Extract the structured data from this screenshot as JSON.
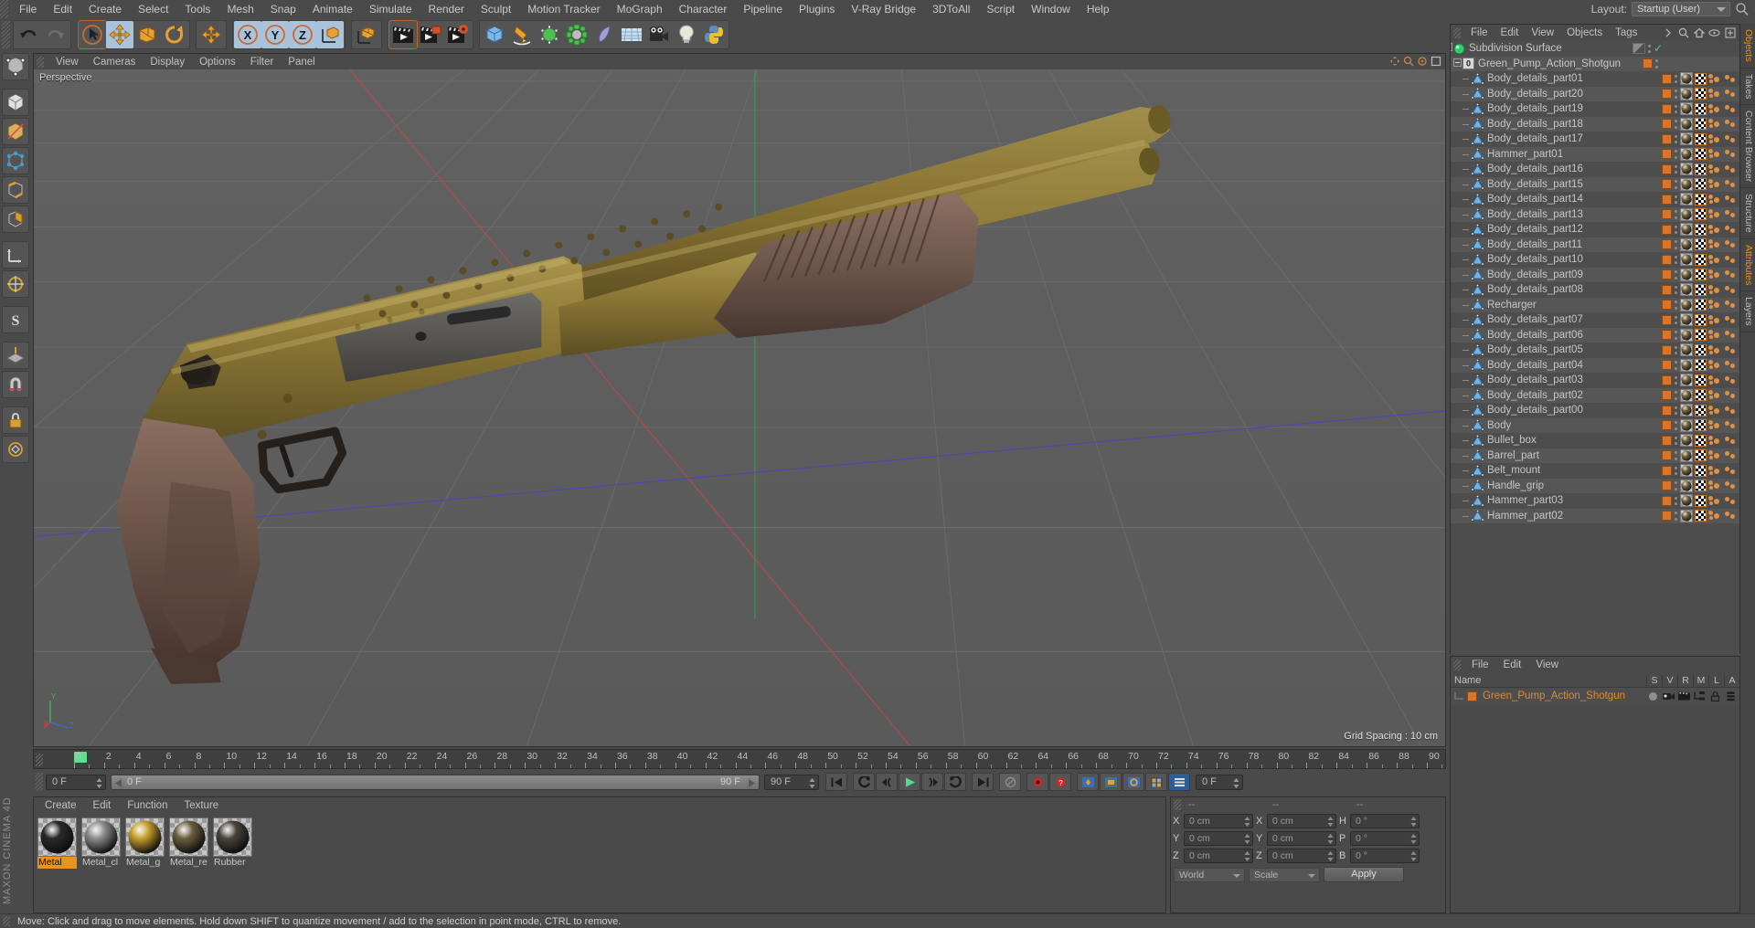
{
  "app": {
    "brand": "MAXON CINEMA 4D",
    "layout_label": "Layout:",
    "layout_value": "Startup (User)"
  },
  "menubar": {
    "items": [
      "File",
      "Edit",
      "Create",
      "Select",
      "Tools",
      "Mesh",
      "Snap",
      "Animate",
      "Simulate",
      "Render",
      "Sculpt",
      "Motion Tracker",
      "MoGraph",
      "Character",
      "Pipeline",
      "Plugins",
      "V-Ray Bridge",
      "3DToAll",
      "Script",
      "Window",
      "Help"
    ]
  },
  "toolbar": {
    "groups": [
      {
        "buttons": [
          {
            "name": "undo-button",
            "icon": "undo",
            "state": "normal"
          },
          {
            "name": "redo-button",
            "icon": "redo",
            "state": "disabled"
          }
        ]
      },
      {
        "buttons": [
          {
            "name": "live-selection-tool",
            "icon": "cursor-circle",
            "state": "hot"
          },
          {
            "name": "move-tool",
            "icon": "move-arrows",
            "state": "selected"
          },
          {
            "name": "scale-tool",
            "icon": "scale-box",
            "state": "normal"
          },
          {
            "name": "rotate-tool",
            "icon": "rotate-circle",
            "state": "normal"
          }
        ]
      },
      {
        "buttons": [
          {
            "name": "move-axis-tool",
            "icon": "move-arrows-2",
            "state": "normal"
          }
        ]
      },
      {
        "buttons": [
          {
            "name": "lock-x-axis",
            "icon": "axis-x",
            "state": "selected"
          },
          {
            "name": "lock-y-axis",
            "icon": "axis-y",
            "state": "selected"
          },
          {
            "name": "lock-z-axis",
            "icon": "axis-z",
            "state": "selected"
          },
          {
            "name": "world-object-coordinate",
            "icon": "world-cube",
            "state": "selected"
          }
        ]
      },
      {
        "buttons": [
          {
            "name": "coordinate-system-button",
            "icon": "cube-axis",
            "state": "normal"
          }
        ]
      },
      {
        "buttons": [
          {
            "name": "render-view-button",
            "icon": "clapper",
            "state": "hot"
          },
          {
            "name": "render-region-button",
            "icon": "clapper-region",
            "state": "normal"
          },
          {
            "name": "render-settings-button",
            "icon": "clapper-gear",
            "state": "normal"
          }
        ]
      },
      {
        "buttons": [
          {
            "name": "add-cube-button",
            "icon": "cube-blue",
            "state": "normal"
          },
          {
            "name": "spline-pen-button",
            "icon": "pen",
            "state": "normal"
          },
          {
            "name": "generator-button",
            "icon": "cube-green",
            "state": "normal"
          },
          {
            "name": "mograph-button",
            "icon": "cluster-green",
            "state": "normal"
          },
          {
            "name": "deformer-button",
            "icon": "bend-purple",
            "state": "normal"
          },
          {
            "name": "scene-object-button",
            "icon": "floor-grid",
            "state": "normal"
          },
          {
            "name": "camera-button",
            "icon": "camera",
            "state": "normal"
          },
          {
            "name": "light-button",
            "icon": "light-bulb",
            "state": "normal"
          },
          {
            "name": "python-button",
            "icon": "python",
            "state": "normal"
          }
        ]
      }
    ]
  },
  "left_toolbar": {
    "buttons": [
      {
        "name": "make-editable-button",
        "icon": "make-editable"
      },
      {
        "name": "model-mode-button",
        "icon": "model-cube"
      },
      {
        "name": "texture-mode-button",
        "icon": "texture-axis"
      },
      {
        "name": "points-mode-button",
        "icon": "points"
      },
      {
        "name": "edges-mode-button",
        "icon": "edges"
      },
      {
        "name": "polygons-mode-button",
        "icon": "polygons"
      },
      {
        "name": "object-axis-button",
        "icon": "object-axis"
      },
      {
        "name": "enable-axis-button",
        "icon": "enable-axis"
      },
      {
        "name": "viewport-solo-button",
        "icon": "viewport-solo"
      },
      {
        "name": "workplane-button",
        "icon": "workplane"
      },
      {
        "name": "snap-button",
        "icon": "magnet"
      },
      {
        "name": "lock-workplane-button",
        "icon": "lock-plane"
      },
      {
        "name": "quantize-button",
        "icon": "quantize"
      }
    ]
  },
  "viewport": {
    "menu": [
      "View",
      "Cameras",
      "Display",
      "Options",
      "Filter",
      "Panel"
    ],
    "camera_name": "Perspective",
    "grid_spacing": "Grid Spacing : 10 cm",
    "axis_labels": [
      "X",
      "Y",
      "Z"
    ]
  },
  "timeline": {
    "ticks": [
      "0",
      "2",
      "4",
      "6",
      "8",
      "10",
      "12",
      "14",
      "16",
      "18",
      "20",
      "22",
      "24",
      "26",
      "28",
      "30",
      "32",
      "34",
      "36",
      "38",
      "40",
      "42",
      "44",
      "46",
      "48",
      "50",
      "52",
      "54",
      "56",
      "58",
      "60",
      "62",
      "64",
      "66",
      "68",
      "70",
      "72",
      "74",
      "76",
      "78",
      "80",
      "82",
      "84",
      "86",
      "88",
      "90"
    ],
    "current_frame": "0 F",
    "start_field": "0 F",
    "preview_min": "0 F",
    "preview_max": "90 F",
    "end_field": "90 F",
    "fps_right": "0 F",
    "transport": [
      {
        "name": "go-to-start-button",
        "icon": "skip-start"
      },
      {
        "name": "previous-keyframe-button",
        "icon": "prev-key"
      },
      {
        "name": "step-back-button",
        "icon": "step-back"
      },
      {
        "name": "play-button",
        "icon": "play"
      },
      {
        "name": "step-forward-button",
        "icon": "step-forward"
      },
      {
        "name": "next-keyframe-button",
        "icon": "next-key"
      },
      {
        "name": "go-to-end-button",
        "icon": "skip-end"
      }
    ],
    "record_buttons": [
      {
        "name": "record-active-objects-button",
        "icon": "record"
      },
      {
        "name": "autokeying-button",
        "icon": "autokey"
      },
      {
        "name": "keyframe-position-button",
        "icon": "key-pos"
      },
      {
        "name": "keyframe-scale-button",
        "icon": "key-scale"
      },
      {
        "name": "keyframe-rotation-button",
        "icon": "key-rot"
      },
      {
        "name": "keyframe-param-button",
        "icon": "key-param"
      },
      {
        "name": "keyframe-pla-button",
        "icon": "key-pla"
      }
    ]
  },
  "materials": {
    "menu": [
      "Create",
      "Edit",
      "Function",
      "Texture"
    ],
    "items": [
      {
        "name": "Metal",
        "selected": true,
        "color": "#2a2a2a"
      },
      {
        "name": "Metal_cl",
        "selected": false,
        "color": "#8d8d8d"
      },
      {
        "name": "Metal_g",
        "selected": false,
        "color": "#c9a02a"
      },
      {
        "name": "Metal_re",
        "selected": false,
        "color": "#6d6040"
      },
      {
        "name": "Rubber",
        "selected": false,
        "color": "#4c443d"
      }
    ]
  },
  "coordinates": {
    "headers": [
      "--",
      "--",
      "--"
    ],
    "rows": [
      {
        "label1": "X",
        "value1": "0 cm",
        "label2": "X",
        "value2": "0 cm",
        "label3": "H",
        "value3": "0 °"
      },
      {
        "label1": "Y",
        "value1": "0 cm",
        "label2": "Y",
        "value2": "0 cm",
        "label3": "P",
        "value3": "0 °"
      },
      {
        "label1": "Z",
        "value1": "0 cm",
        "label2": "Z",
        "value2": "0 cm",
        "label3": "B",
        "value3": "0 °"
      }
    ],
    "system": "World",
    "mode": "Scale",
    "apply_label": "Apply"
  },
  "object_manager": {
    "menu": [
      "File",
      "Edit",
      "View",
      "Objects",
      "Tags"
    ],
    "icons": [
      "search-icon",
      "home-icon",
      "eye-icon",
      "expand-icon"
    ],
    "items": [
      {
        "label": "Subdivision Surface",
        "icon": "subdivision-surface-icon",
        "depth": 0,
        "has_tag": false,
        "checked": true
      },
      {
        "label": "Green_Pump_Action_Shotgun",
        "icon": "layer-null-icon",
        "depth": 1,
        "has_tag": true,
        "tags": 0
      },
      {
        "label": "Body_details_part01",
        "icon": "polygon-object-icon",
        "depth": 2,
        "has_tag": true,
        "tags": 3
      },
      {
        "label": "Body_details_part20",
        "icon": "polygon-object-icon",
        "depth": 2,
        "has_tag": true,
        "tags": 3
      },
      {
        "label": "Body_details_part19",
        "icon": "polygon-object-icon",
        "depth": 2,
        "has_tag": true,
        "tags": 3
      },
      {
        "label": "Body_details_part18",
        "icon": "polygon-object-icon",
        "depth": 2,
        "has_tag": true,
        "tags": 3
      },
      {
        "label": "Body_details_part17",
        "icon": "polygon-object-icon",
        "depth": 2,
        "has_tag": true,
        "tags": 3
      },
      {
        "label": "Hammer_part01",
        "icon": "polygon-object-icon",
        "depth": 2,
        "has_tag": true,
        "tags": 3
      },
      {
        "label": "Body_details_part16",
        "icon": "polygon-object-icon",
        "depth": 2,
        "has_tag": true,
        "tags": 3
      },
      {
        "label": "Body_details_part15",
        "icon": "polygon-object-icon",
        "depth": 2,
        "has_tag": true,
        "tags": 3
      },
      {
        "label": "Body_details_part14",
        "icon": "polygon-object-icon",
        "depth": 2,
        "has_tag": true,
        "tags": 3
      },
      {
        "label": "Body_details_part13",
        "icon": "polygon-object-icon",
        "depth": 2,
        "has_tag": true,
        "tags": 3
      },
      {
        "label": "Body_details_part12",
        "icon": "polygon-object-icon",
        "depth": 2,
        "has_tag": true,
        "tags": 3
      },
      {
        "label": "Body_details_part11",
        "icon": "polygon-object-icon",
        "depth": 2,
        "has_tag": true,
        "tags": 3
      },
      {
        "label": "Body_details_part10",
        "icon": "polygon-object-icon",
        "depth": 2,
        "has_tag": true,
        "tags": 3
      },
      {
        "label": "Body_details_part09",
        "icon": "polygon-object-icon",
        "depth": 2,
        "has_tag": true,
        "tags": 3
      },
      {
        "label": "Body_details_part08",
        "icon": "polygon-object-icon",
        "depth": 2,
        "has_tag": true,
        "tags": 3
      },
      {
        "label": "Recharger",
        "icon": "polygon-object-icon",
        "depth": 2,
        "has_tag": true,
        "tags": 3
      },
      {
        "label": "Body_details_part07",
        "icon": "polygon-object-icon",
        "depth": 2,
        "has_tag": true,
        "tags": 3
      },
      {
        "label": "Body_details_part06",
        "icon": "polygon-object-icon",
        "depth": 2,
        "has_tag": true,
        "tags": 3
      },
      {
        "label": "Body_details_part05",
        "icon": "polygon-object-icon",
        "depth": 2,
        "has_tag": true,
        "tags": 3
      },
      {
        "label": "Body_details_part04",
        "icon": "polygon-object-icon",
        "depth": 2,
        "has_tag": true,
        "tags": 3
      },
      {
        "label": "Body_details_part03",
        "icon": "polygon-object-icon",
        "depth": 2,
        "has_tag": true,
        "tags": 3
      },
      {
        "label": "Body_details_part02",
        "icon": "polygon-object-icon",
        "depth": 2,
        "has_tag": true,
        "tags": 3
      },
      {
        "label": "Body_details_part00",
        "icon": "polygon-object-icon",
        "depth": 2,
        "has_tag": true,
        "tags": 3
      },
      {
        "label": "Body",
        "icon": "polygon-object-icon",
        "depth": 2,
        "has_tag": true,
        "tags": 3
      },
      {
        "label": "Bullet_box",
        "icon": "polygon-object-icon",
        "depth": 2,
        "has_tag": true,
        "tags": 3
      },
      {
        "label": "Barrel_part",
        "icon": "polygon-object-icon",
        "depth": 2,
        "has_tag": true,
        "tags": 3
      },
      {
        "label": "Belt_mount",
        "icon": "polygon-object-icon",
        "depth": 2,
        "has_tag": true,
        "tags": 3
      },
      {
        "label": "Handle_grip",
        "icon": "polygon-object-icon",
        "depth": 2,
        "has_tag": true,
        "tags": 3
      },
      {
        "label": "Hammer_part03",
        "icon": "polygon-object-icon",
        "depth": 2,
        "has_tag": true,
        "tags": 3
      },
      {
        "label": "Hammer_part02",
        "icon": "polygon-object-icon",
        "depth": 2,
        "has_tag": true,
        "tags": 3
      }
    ]
  },
  "layer_manager": {
    "menu": [
      "File",
      "Edit",
      "View"
    ],
    "name_header": "Name",
    "columns": [
      "S",
      "V",
      "R",
      "M",
      "L",
      "A"
    ],
    "rows": [
      {
        "label": "Green_Pump_Action_Shotgun",
        "color": "#d9742a"
      }
    ]
  },
  "right_dock": {
    "tabs": [
      "Objects",
      "Takes",
      "Content Browser",
      "Structure",
      "Attributes",
      "Layers"
    ]
  },
  "status_bar": {
    "message": "Move: Click and drag to move elements. Hold down SHIFT to quantize movement / add to the selection in point mode, CTRL to remove."
  },
  "colors": {
    "accent_orange": "#e8941c",
    "tag_orange": "#d9742a",
    "selection_blue": "#a9c3dd",
    "panel_bg": "#4a4a4a",
    "viewport_bg": "#5c5c5c",
    "model_body": "#8a7434",
    "model_grip": "#6b5348"
  }
}
